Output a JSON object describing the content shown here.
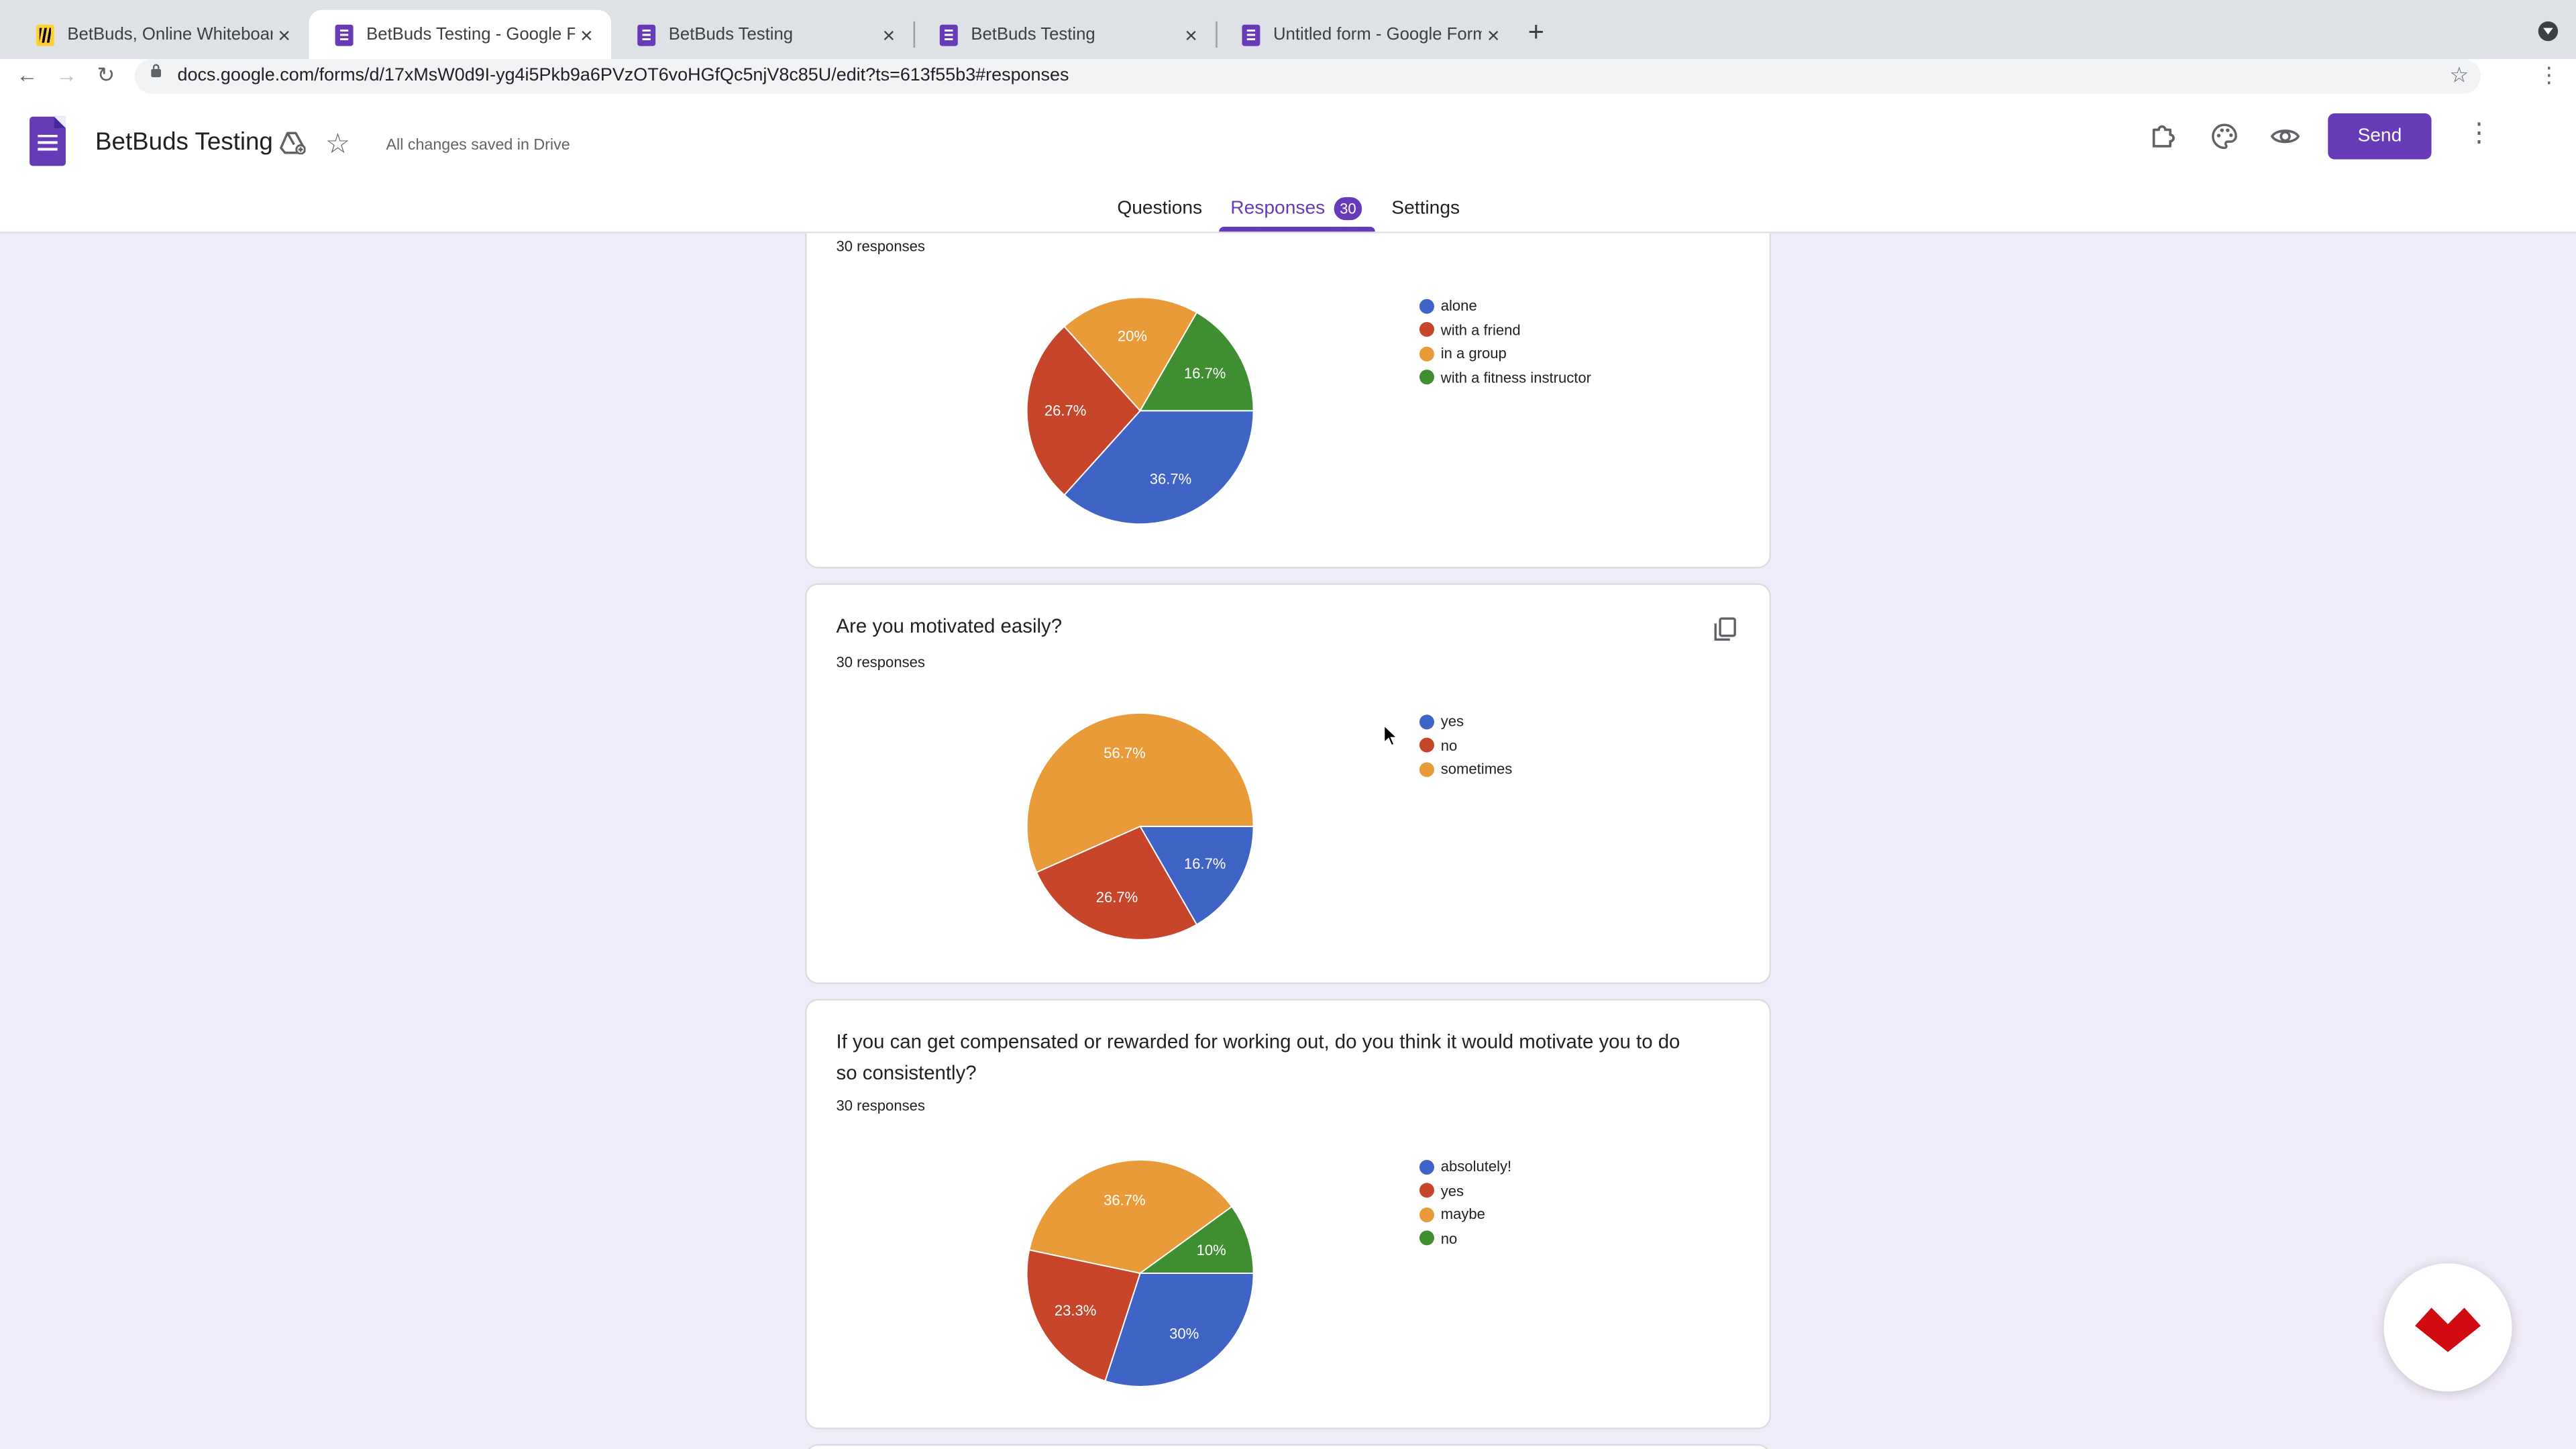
{
  "browser": {
    "tabs": [
      {
        "title": "BetBuds, Online Whiteboard fo"
      },
      {
        "title": "BetBuds Testing - Google Form"
      },
      {
        "title": "BetBuds Testing"
      },
      {
        "title": "BetBuds Testing"
      },
      {
        "title": "Untitled form - Google Forms"
      }
    ],
    "new_tab": "+",
    "close": "×",
    "url": "docs.google.com/forms/d/17xMsW0d9I-yg4i5Pkb9a6PVzOT6voHGfQc5njV8c85U/edit?ts=613f55b3#responses"
  },
  "form": {
    "title": "BetBuds Testing",
    "save_status": "All changes saved in Drive",
    "send_label": "Send",
    "tabs": {
      "questions": "Questions",
      "responses": "Responses",
      "responses_count": "30",
      "settings": "Settings"
    }
  },
  "questions": [
    {
      "title": "",
      "responses_label": "30 responses",
      "chart_data": {
        "type": "pie",
        "categories": [
          "alone",
          "with a friend",
          "in a group",
          "with a fitness instructor"
        ],
        "values": [
          36.7,
          26.7,
          20,
          16.7
        ],
        "labels": [
          "36.7%",
          "26.7%",
          "20%",
          "16.7%"
        ],
        "colors": [
          "#4063c6",
          "#c7452b",
          "#ea9b39",
          "#3f8e32"
        ],
        "legend": "right"
      }
    },
    {
      "title": "Are you motivated easily?",
      "responses_label": "30 responses",
      "chart_data": {
        "type": "pie",
        "categories": [
          "yes",
          "no",
          "sometimes"
        ],
        "values": [
          16.7,
          26.7,
          56.7
        ],
        "labels": [
          "16.7%",
          "26.7%",
          "56.7%"
        ],
        "colors": [
          "#4063c6",
          "#c7452b",
          "#ea9b39"
        ],
        "legend": "right"
      }
    },
    {
      "title": "If you can get compensated or rewarded for working out, do you think it would motivate you to do so consistently?",
      "responses_label": "30 responses",
      "chart_data": {
        "type": "pie",
        "categories": [
          "absolutely!",
          "yes",
          "maybe",
          "no"
        ],
        "values": [
          30,
          23.3,
          36.7,
          10
        ],
        "labels": [
          "30%",
          "23.3%",
          "36.7%",
          "10%"
        ],
        "colors": [
          "#4063c6",
          "#c7452b",
          "#ea9b39",
          "#3f8e32"
        ],
        "legend": "right"
      }
    }
  ],
  "colors": {
    "accent": "#673ab7",
    "background": "#f0ebf8",
    "fab_logo": "#d20a11"
  }
}
